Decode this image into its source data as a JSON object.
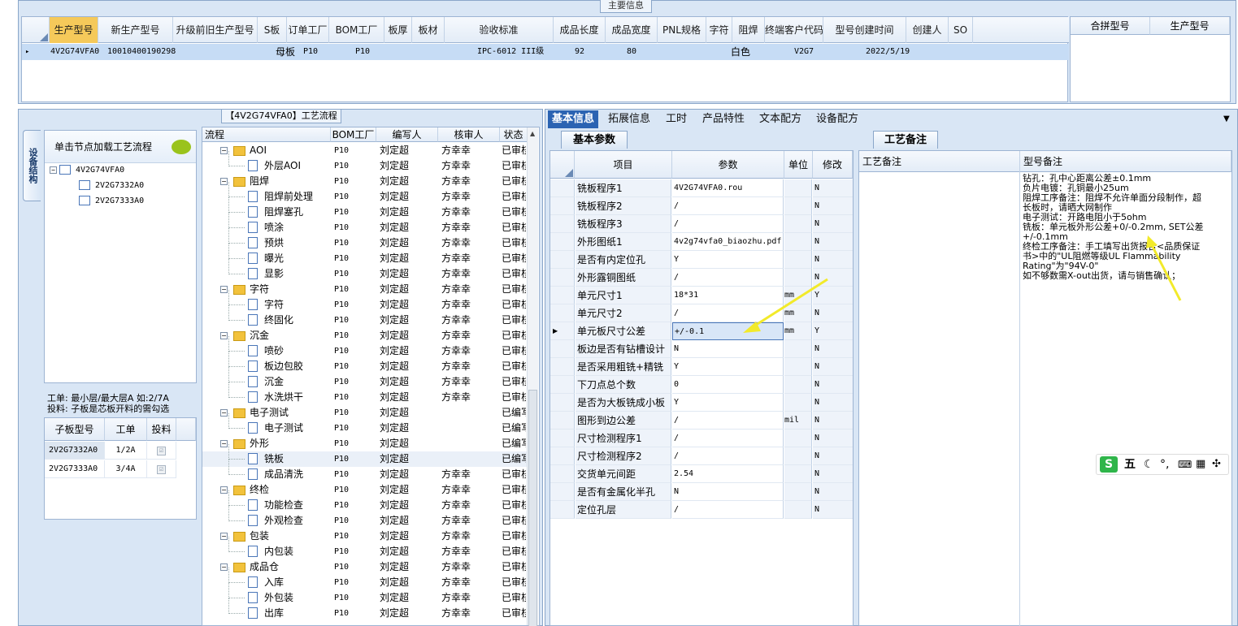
{
  "top": {
    "title": "主要信息",
    "columns": [
      "生产型号",
      "新生产型号",
      "升级前旧生产型号",
      "S板",
      "订单工厂",
      "BOM工厂",
      "板厚",
      "板材",
      "验收标准",
      "成品长度",
      "成品宽度",
      "PNL规格",
      "字符",
      "阻焊",
      "终端客户代码",
      "型号创建时间",
      "创建人",
      "SO"
    ],
    "row": {
      "marker": "▸",
      "prod_model": "4V2G74VFA0",
      "new_model": "10010400190298",
      "s_board": "母板",
      "order_factory": "P10",
      "bom_factory": "P10",
      "standard": "IPC-6012 III级",
      "length": "92",
      "width": "80",
      "character": "白色",
      "customer": "V2G7",
      "created": "2022/5/19"
    },
    "side_columns": [
      "合拼型号",
      "生产型号"
    ]
  },
  "process": {
    "title": "【4V2G74VFA0】工艺流程",
    "vtab": "设备结构",
    "load_button": "单击节点加载工艺流程",
    "tree": {
      "root": "4V2G74VFA0",
      "children": [
        "2V2G7332A0",
        "2V2G7333A0"
      ]
    },
    "note_line1": "工单: 最小层/最大层A 如:2/7A",
    "note_line2": "投料: 子板是芯板开料的需勾选",
    "sub_columns": [
      "子板型号",
      "工单",
      "投料"
    ],
    "sub_rows": [
      {
        "model": "2V2G7332A0",
        "order": "1/2A",
        "check": "☑"
      },
      {
        "model": "2V2G7333A0",
        "order": "3/4A",
        "check": "☑"
      }
    ],
    "flow_columns": [
      "流程",
      "BOM工厂",
      "编写人",
      "核审人",
      "状态"
    ],
    "flow_rows": [
      {
        "name": "AOI",
        "folder": true,
        "factory": "P10",
        "writer": "刘定超",
        "reviewer": "方幸幸",
        "status": "已审核"
      },
      {
        "name": "外层AOI",
        "folder": false,
        "factory": "P10",
        "writer": "刘定超",
        "reviewer": "方幸幸",
        "status": "已审核"
      },
      {
        "name": "阻焊",
        "folder": true,
        "factory": "P10",
        "writer": "刘定超",
        "reviewer": "方幸幸",
        "status": "已审核"
      },
      {
        "name": "阻焊前处理",
        "folder": false,
        "factory": "P10",
        "writer": "刘定超",
        "reviewer": "方幸幸",
        "status": "已审核"
      },
      {
        "name": "阻焊塞孔",
        "folder": false,
        "factory": "P10",
        "writer": "刘定超",
        "reviewer": "方幸幸",
        "status": "已审核"
      },
      {
        "name": "喷涂",
        "folder": false,
        "factory": "P10",
        "writer": "刘定超",
        "reviewer": "方幸幸",
        "status": "已审核"
      },
      {
        "name": "预烘",
        "folder": false,
        "factory": "P10",
        "writer": "刘定超",
        "reviewer": "方幸幸",
        "status": "已审核"
      },
      {
        "name": "曝光",
        "folder": false,
        "factory": "P10",
        "writer": "刘定超",
        "reviewer": "方幸幸",
        "status": "已审核"
      },
      {
        "name": "显影",
        "folder": false,
        "factory": "P10",
        "writer": "刘定超",
        "reviewer": "方幸幸",
        "status": "已审核"
      },
      {
        "name": "字符",
        "folder": true,
        "factory": "P10",
        "writer": "刘定超",
        "reviewer": "方幸幸",
        "status": "已审核"
      },
      {
        "name": "字符",
        "folder": false,
        "factory": "P10",
        "writer": "刘定超",
        "reviewer": "方幸幸",
        "status": "已审核"
      },
      {
        "name": "终固化",
        "folder": false,
        "factory": "P10",
        "writer": "刘定超",
        "reviewer": "方幸幸",
        "status": "已审核"
      },
      {
        "name": "沉金",
        "folder": true,
        "factory": "P10",
        "writer": "刘定超",
        "reviewer": "方幸幸",
        "status": "已审核"
      },
      {
        "name": "喷砂",
        "folder": false,
        "factory": "P10",
        "writer": "刘定超",
        "reviewer": "方幸幸",
        "status": "已审核"
      },
      {
        "name": "板边包胶",
        "folder": false,
        "factory": "P10",
        "writer": "刘定超",
        "reviewer": "方幸幸",
        "status": "已审核"
      },
      {
        "name": "沉金",
        "folder": false,
        "factory": "P10",
        "writer": "刘定超",
        "reviewer": "方幸幸",
        "status": "已审核"
      },
      {
        "name": "水洗烘干",
        "folder": false,
        "factory": "P10",
        "writer": "刘定超",
        "reviewer": "方幸幸",
        "status": "已审核"
      },
      {
        "name": "电子测试",
        "folder": true,
        "factory": "P10",
        "writer": "刘定超",
        "reviewer": "",
        "status": "已编写"
      },
      {
        "name": "电子测试",
        "folder": false,
        "factory": "P10",
        "writer": "刘定超",
        "reviewer": "",
        "status": "已编写"
      },
      {
        "name": "外形",
        "folder": true,
        "factory": "P10",
        "writer": "刘定超",
        "reviewer": "",
        "status": "已编写"
      },
      {
        "name": "铣板",
        "folder": false,
        "factory": "P10",
        "writer": "刘定超",
        "reviewer": "",
        "status": "已编写"
      },
      {
        "name": "成品清洗",
        "folder": false,
        "factory": "P10",
        "writer": "刘定超",
        "reviewer": "方幸幸",
        "status": "已审核"
      },
      {
        "name": "终检",
        "folder": true,
        "factory": "P10",
        "writer": "刘定超",
        "reviewer": "方幸幸",
        "status": "已审核"
      },
      {
        "name": "功能检查",
        "folder": false,
        "factory": "P10",
        "writer": "刘定超",
        "reviewer": "方幸幸",
        "status": "已审核"
      },
      {
        "name": "外观检查",
        "folder": false,
        "factory": "P10",
        "writer": "刘定超",
        "reviewer": "方幸幸",
        "status": "已审核"
      },
      {
        "name": "包装",
        "folder": true,
        "factory": "P10",
        "writer": "刘定超",
        "reviewer": "方幸幸",
        "status": "已审核"
      },
      {
        "name": "内包装",
        "folder": false,
        "factory": "P10",
        "writer": "刘定超",
        "reviewer": "方幸幸",
        "status": "已审核"
      },
      {
        "name": "成品仓",
        "folder": true,
        "factory": "P10",
        "writer": "刘定超",
        "reviewer": "方幸幸",
        "status": "已审核"
      },
      {
        "name": "入库",
        "folder": false,
        "factory": "P10",
        "writer": "刘定超",
        "reviewer": "方幸幸",
        "status": "已审核"
      },
      {
        "name": "外包装",
        "folder": false,
        "factory": "P10",
        "writer": "刘定超",
        "reviewer": "方幸幸",
        "status": "已审核"
      },
      {
        "name": "出库",
        "folder": false,
        "factory": "P10",
        "writer": "刘定超",
        "reviewer": "方幸幸",
        "status": "已审核"
      }
    ]
  },
  "right": {
    "tabs": [
      "基本信息",
      "拓展信息",
      "工时",
      "产品特性",
      "文本配方",
      "设备配方"
    ],
    "basic_tab": "基本参数",
    "craft_tab": "工艺备注",
    "param_columns": [
      "项目",
      "参数",
      "单位",
      "修改"
    ],
    "params": [
      {
        "item": "铣板程序1",
        "value": "4V2G74VFA0.rou",
        "unit": "",
        "mod": "N"
      },
      {
        "item": "铣板程序2",
        "value": "/",
        "unit": "",
        "mod": "N"
      },
      {
        "item": "铣板程序3",
        "value": "/",
        "unit": "",
        "mod": "N"
      },
      {
        "item": "外形图纸1",
        "value": "4v2g74vfa0_biaozhu.pdf",
        "unit": "",
        "mod": "N"
      },
      {
        "item": "是否有内定位孔",
        "value": "Y",
        "unit": "",
        "mod": "N"
      },
      {
        "item": "外形露铜图纸",
        "value": "/",
        "unit": "",
        "mod": "N"
      },
      {
        "item": "单元尺寸1",
        "value": "18*31",
        "unit": "mm",
        "mod": "Y"
      },
      {
        "item": "单元尺寸2",
        "value": "/",
        "unit": "mm",
        "mod": "N"
      },
      {
        "item": "单元板尺寸公差",
        "value": "+/-0.1",
        "unit": "mm",
        "mod": "Y"
      },
      {
        "item": "板边是否有钻槽设计",
        "value": "N",
        "unit": "",
        "mod": "N"
      },
      {
        "item": "是否采用粗铣+精铣",
        "value": "Y",
        "unit": "",
        "mod": "N"
      },
      {
        "item": "下刀点总个数",
        "value": "0",
        "unit": "",
        "mod": "N"
      },
      {
        "item": "是否为大板铣成小板",
        "value": "Y",
        "unit": "",
        "mod": "N"
      },
      {
        "item": "图形到边公差",
        "value": "/",
        "unit": "mil",
        "mod": "N"
      },
      {
        "item": "尺寸检测程序1",
        "value": "/",
        "unit": "",
        "mod": "N"
      },
      {
        "item": "尺寸检测程序2",
        "value": "/",
        "unit": "",
        "mod": "N"
      },
      {
        "item": "交货单元间距",
        "value": "2.54",
        "unit": "",
        "mod": "N"
      },
      {
        "item": "是否有金属化半孔",
        "value": "N",
        "unit": "",
        "mod": "N"
      },
      {
        "item": "定位孔层",
        "value": "/",
        "unit": "",
        "mod": "N"
      }
    ],
    "note_columns": [
      "工艺备注",
      "型号备注"
    ],
    "model_note_lines": [
      "钻孔：孔中心距离公差±0.1mm",
      "负片电镀：孔铜最小25um",
      "阻焊工序备注：阻焊不允许单面分段制作，超",
      "长板时，请晒大网制作",
      "电子测试：开路电阻小于5ohm",
      "铣板：单元板外形公差+0/-0.2mm, SET公差",
      "+/-0.1mm",
      "终检工序备注：手工填写出货报告<品质保证",
      "书>中的\"UL阻燃等级UL Flammability",
      "Rating\"为\"94V-0\"",
      "如不够数需X-out出货，请与销售确认；"
    ]
  },
  "ime": {
    "logo": "S",
    "label": "五"
  }
}
